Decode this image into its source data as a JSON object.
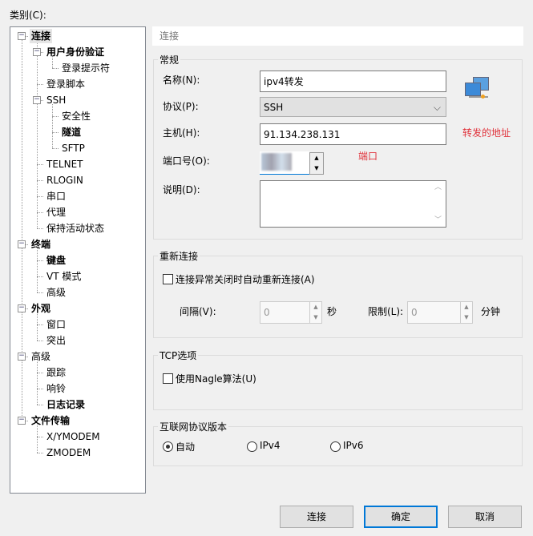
{
  "category_label": "类别(C):",
  "tree": [
    {
      "label": "连接",
      "level": 0,
      "bold": true,
      "expand": true
    },
    {
      "label": "用户身份验证",
      "level": 1,
      "bold": true,
      "expand": true
    },
    {
      "label": "登录提示符",
      "level": 2
    },
    {
      "label": "登录脚本",
      "level": 1
    },
    {
      "label": "SSH",
      "level": 1,
      "expand": true
    },
    {
      "label": "安全性",
      "level": 2
    },
    {
      "label": "隧道",
      "level": 2,
      "bold": true
    },
    {
      "label": "SFTP",
      "level": 2
    },
    {
      "label": "TELNET",
      "level": 1
    },
    {
      "label": "RLOGIN",
      "level": 1
    },
    {
      "label": "串口",
      "level": 1
    },
    {
      "label": "代理",
      "level": 1
    },
    {
      "label": "保持活动状态",
      "level": 1
    },
    {
      "label": "终端",
      "level": 0,
      "bold": true,
      "expand": true
    },
    {
      "label": "键盘",
      "level": 1,
      "bold": true
    },
    {
      "label": "VT 模式",
      "level": 1
    },
    {
      "label": "高级",
      "level": 1
    },
    {
      "label": "外观",
      "level": 0,
      "bold": true,
      "expand": true
    },
    {
      "label": "窗口",
      "level": 1
    },
    {
      "label": "突出",
      "level": 1
    },
    {
      "label": "高级",
      "level": 0,
      "expand": true
    },
    {
      "label": "跟踪",
      "level": 1
    },
    {
      "label": "响铃",
      "level": 1
    },
    {
      "label": "日志记录",
      "level": 1,
      "bold": true
    },
    {
      "label": "文件传输",
      "level": 0,
      "bold": true,
      "expand": true
    },
    {
      "label": "X/YMODEM",
      "level": 1
    },
    {
      "label": "ZMODEM",
      "level": 1
    }
  ],
  "header": "连接",
  "general": {
    "title": "常规",
    "name_label": "名称(N):",
    "name_value": "ipv4转发",
    "protocol_label": "协议(P):",
    "protocol_value": "SSH",
    "host_label": "主机(H):",
    "host_value": "91.134.238.131",
    "host_note": "转发的地址",
    "port_label": "端口号(O):",
    "port_note": "端口",
    "desc_label": "说明(D):"
  },
  "reconnect": {
    "title": "重新连接",
    "checkbox": "连接异常关闭时自动重新连接(A)",
    "interval_label": "间隔(V):",
    "interval_value": "0",
    "interval_unit": "秒",
    "limit_label": "限制(L):",
    "limit_value": "0",
    "limit_unit": "分钟"
  },
  "tcp": {
    "title": "TCP选项",
    "checkbox": "使用Nagle算法(U)"
  },
  "ipver": {
    "title": "互联网协议版本",
    "options": [
      "自动",
      "IPv4",
      "IPv6"
    ],
    "selected": "自动"
  },
  "buttons": {
    "connect": "连接",
    "ok": "确定",
    "cancel": "取消"
  },
  "colors": {
    "note": "#e0313a",
    "accent": "#0078d7"
  }
}
